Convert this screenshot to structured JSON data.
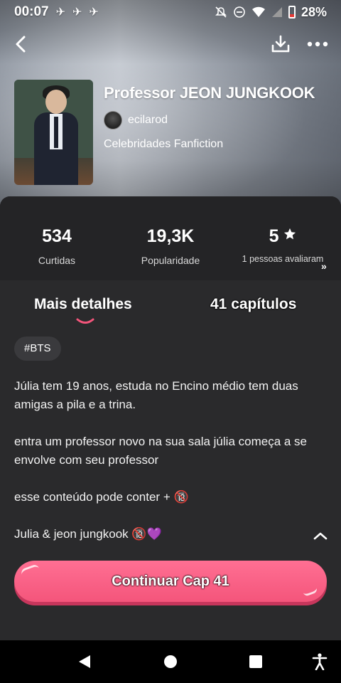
{
  "status_bar": {
    "time": "00:07",
    "battery_percent": "28%",
    "left_icons": [
      "notification-icon",
      "notification-icon",
      "notification-icon"
    ],
    "right_icons": [
      "mute-icon",
      "dnd-icon",
      "wifi-icon",
      "signal-icon",
      "battery-icon"
    ]
  },
  "story": {
    "title": "Professor JEON JUNGKOOK",
    "author": "ecilarod",
    "category": "Celebridades Fanfiction"
  },
  "stats": [
    {
      "value": "534",
      "label": "Curtidas"
    },
    {
      "value": "19,3K",
      "label": "Popularidade"
    },
    {
      "value": "5",
      "label": "1 pessoas avaliaram"
    }
  ],
  "tabs": {
    "details": "Mais detalhes",
    "chapters": "41 capítulos"
  },
  "tag": "#BTS",
  "description": [
    "Júlia tem 19 anos, estuda no Encino médio tem duas amigas a pila e a trina.",
    "entra um professor novo na sua sala júlia começa a se envolve com seu professor",
    "esse conteúdo pode conter + 🔞",
    "Julia & jeon jungkook 🔞💜"
  ],
  "cta_label": "Continuar Cap 41",
  "colors": {
    "accent": "#f4557b",
    "panel_bg": "#2a2a2c",
    "stats_bg": "#242426"
  }
}
